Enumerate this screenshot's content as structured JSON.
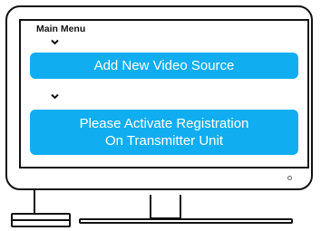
{
  "menu": {
    "title": "Main Menu",
    "actions": [
      {
        "label_lines": [
          "Add New Video Source"
        ]
      },
      {
        "label_lines": [
          "Please Activate Registration",
          "On Transmitter Unit"
        ]
      }
    ]
  },
  "icons": {
    "flow_arrow": "chevron-down-icon",
    "power_indicator": "power-led-icon"
  },
  "colors": {
    "accent": "#10aef0",
    "outline": "#111111"
  }
}
